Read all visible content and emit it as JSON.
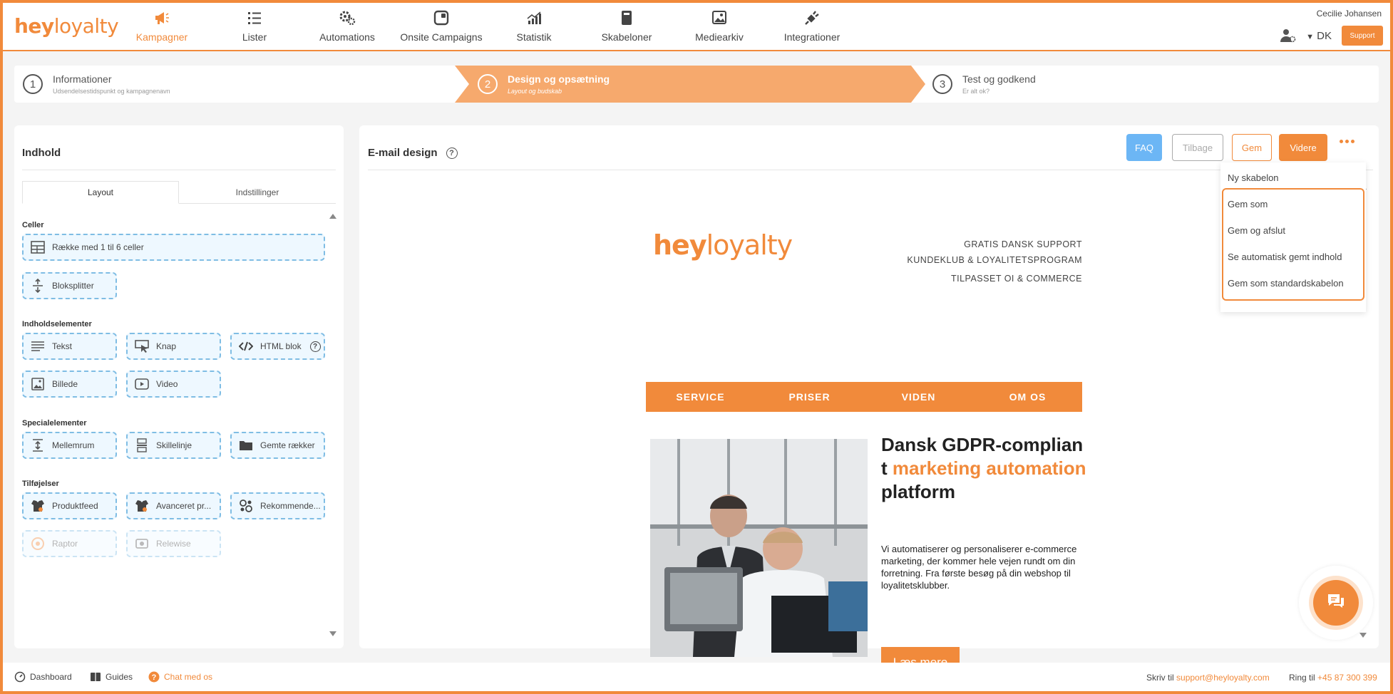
{
  "brand": {
    "logo_bold": "hey",
    "logo_rest": "loyalty",
    "accent": "#f18a3b",
    "info_blue": "#6cb6f5"
  },
  "nav": {
    "items": [
      {
        "label": "Kampagner",
        "icon": "megaphone-icon",
        "active": true
      },
      {
        "label": "Lister",
        "icon": "list-icon"
      },
      {
        "label": "Automations",
        "icon": "gears-icon"
      },
      {
        "label": "Onsite Campaigns",
        "icon": "onsite-icon"
      },
      {
        "label": "Statistik",
        "icon": "bar-chart-icon"
      },
      {
        "label": "Skabeloner",
        "icon": "template-icon"
      },
      {
        "label": "Mediearkiv",
        "icon": "image-icon"
      },
      {
        "label": "Integrationer",
        "icon": "plug-icon"
      }
    ],
    "user_name": "Cecilie Johansen",
    "language": "DK",
    "support_label": "Support"
  },
  "stepper": {
    "steps": [
      {
        "num": "1",
        "title": "Informationer",
        "subtitle": "Udsendelsestidspunkt og kampagnenavn"
      },
      {
        "num": "2",
        "title": "Design og opsætning",
        "subtitle": "Layout og budskab",
        "active": true
      },
      {
        "num": "3",
        "title": "Test og godkend",
        "subtitle": "Er alt ok?"
      }
    ]
  },
  "left": {
    "title": "Indhold",
    "tabs": [
      "Layout",
      "Indstillinger"
    ],
    "sections": {
      "celler": "Celler",
      "indhold": "Indholdselementer",
      "special": "Specialelementer",
      "tilfoj": "Tilføjelser"
    },
    "elements": {
      "row": "Række med 1 til 6 celler",
      "splitter": "Bloksplitter",
      "text": "Tekst",
      "button": "Knap",
      "html": "HTML blok",
      "image": "Billede",
      "video": "Video",
      "spacer": "Mellemrum",
      "divider": "Skillelinje",
      "saved_rows": "Gemte rækker",
      "productfeed": "Produktfeed",
      "advanced": "Avanceret pr...",
      "recommend": "Rekommende...",
      "raptor": "Raptor",
      "relewise": "Relewise"
    }
  },
  "editor": {
    "title": "E-mail design",
    "buttons": {
      "faq": "FAQ",
      "back": "Tilbage",
      "save": "Gem",
      "next": "Videre"
    },
    "dropdown": [
      "Ny skabelon",
      "Gem som",
      "Gem og afslut",
      "Se automatisk gemt indhold",
      "Gem som standardskabelon"
    ]
  },
  "email": {
    "logo_bold": "hey",
    "logo_rest": "loyalty",
    "tagline": [
      "GRATIS DANSK SUPPORT",
      "KUNDEKLUB & LOYALITETSPROGRAM",
      "TILPASSET OI & COMMERCE"
    ],
    "menu": [
      "SERVICE",
      "PRISER",
      "VIDEN",
      "OM OS"
    ],
    "headline": {
      "a": "Dansk GDPR-compliant ",
      "b": "marketing automation",
      "c": " platform"
    },
    "body": "Vi automatiserer og personaliserer e-commerce marketing, der kommer hele vejen rundt om din forretning. Fra første besøg på din webshop til loyalitetsklubber.",
    "cta": "Læs mere"
  },
  "footer": {
    "dashboard": "Dashboard",
    "guides": "Guides",
    "chat": "Chat med os",
    "write_label": "Skriv til",
    "email": "support@heyloyalty.com",
    "call_label": "Ring til",
    "phone": "+45 87 300 399"
  }
}
